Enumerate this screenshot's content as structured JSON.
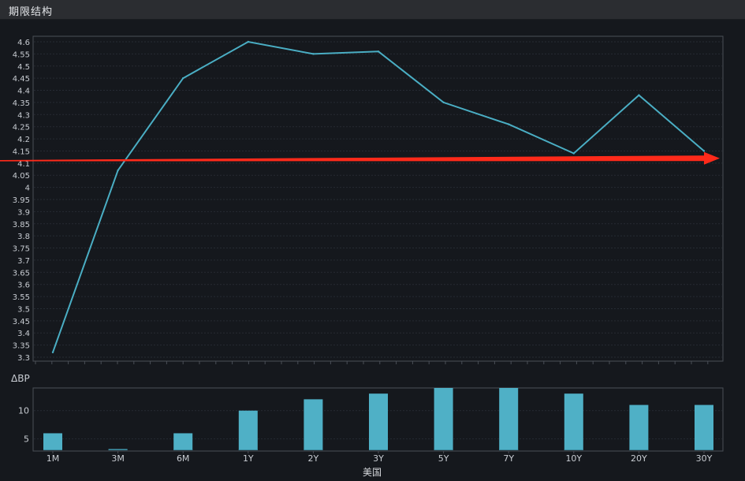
{
  "panel": {
    "title": "期限结构"
  },
  "chart_data": [
    {
      "type": "line",
      "categories": [
        "1M",
        "3M",
        "6M",
        "1Y",
        "2Y",
        "3Y",
        "5Y",
        "7Y",
        "10Y",
        "20Y",
        "30Y"
      ],
      "series": [
        {
          "values": [
            3.32,
            4.07,
            4.45,
            4.6,
            4.55,
            4.56,
            4.35,
            4.26,
            4.14,
            4.38,
            4.15
          ]
        }
      ],
      "ylim": [
        3.3,
        4.6
      ],
      "yticks": [
        "4.6",
        "4.55",
        "4.5",
        "4.45",
        "4.4",
        "4.35",
        "4.3",
        "4.25",
        "4.2",
        "4.15",
        "4.1",
        "4.05",
        "4",
        "3.95",
        "3.9",
        "3.85",
        "3.8",
        "3.75",
        "3.7",
        "3.65",
        "3.6",
        "3.55",
        "3.5",
        "3.45",
        "3.4",
        "3.35",
        "3.3"
      ],
      "annotation": {
        "type": "arrow",
        "color": "#ff2a1a",
        "y_start": 4.11,
        "y_end": 4.12
      },
      "grid": true,
      "colors": {
        "line": "#4aaec4",
        "grid": "#262b33",
        "axis": "#4a4f57"
      }
    },
    {
      "type": "bar",
      "categories": [
        "1M",
        "3M",
        "6M",
        "1Y",
        "2Y",
        "3Y",
        "5Y",
        "7Y",
        "10Y",
        "20Y",
        "30Y"
      ],
      "values": [
        6,
        0,
        6,
        10,
        12,
        13,
        14,
        14,
        13,
        11,
        11
      ],
      "ylabel": "ΔBP",
      "xlabel": "美国",
      "yticks": [
        "10",
        "5"
      ],
      "ylim": [
        3,
        14
      ],
      "grid": true,
      "colors": {
        "bar": "#4fb0c6",
        "bar_base": "#3a8ea3"
      }
    }
  ]
}
